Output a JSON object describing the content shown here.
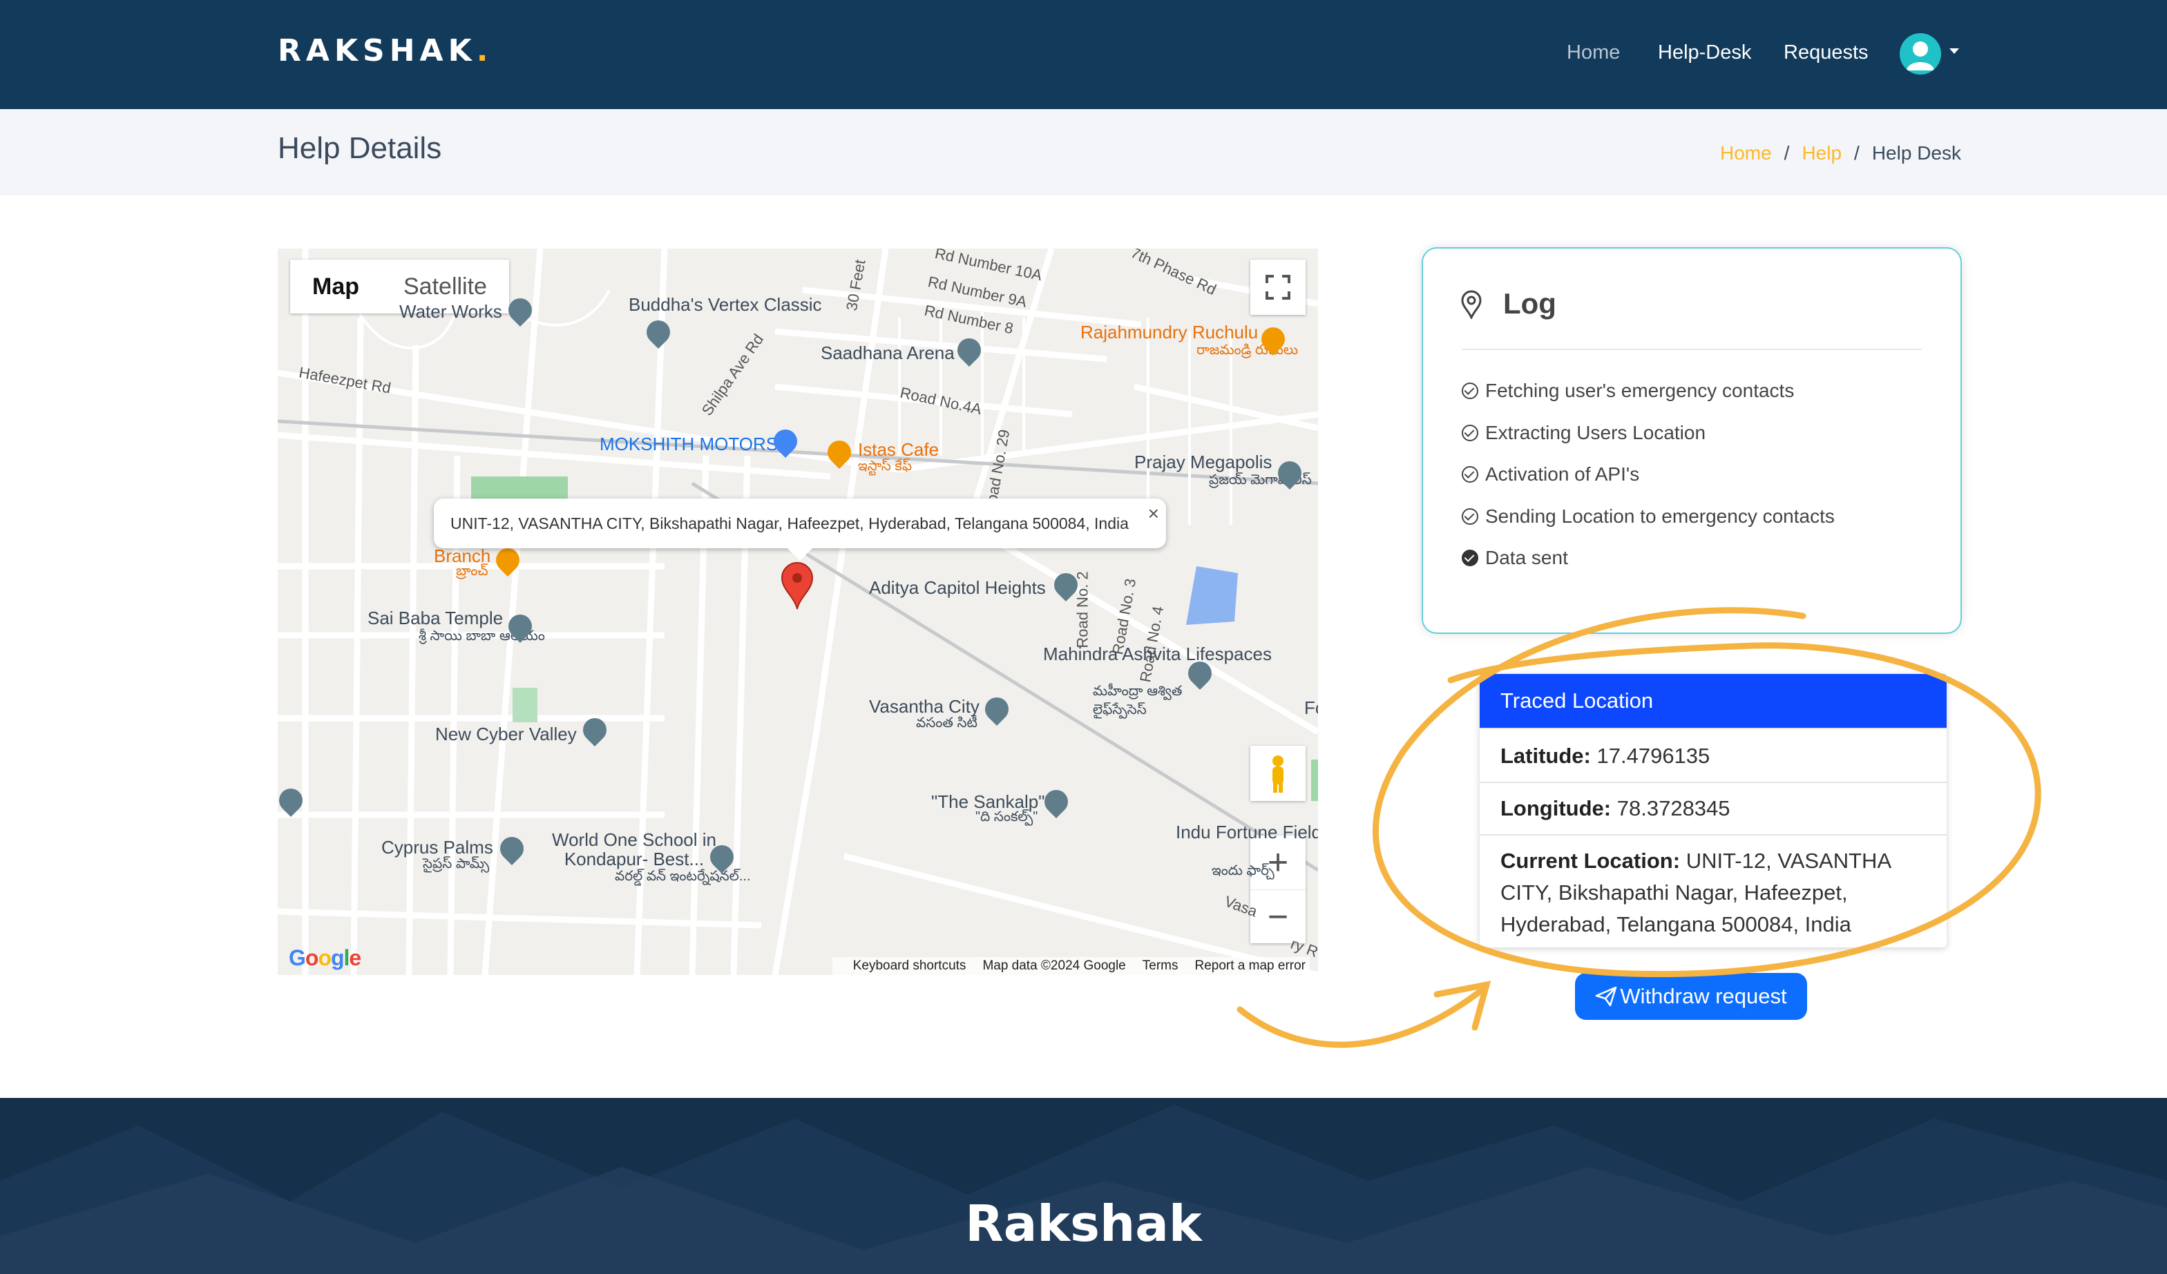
{
  "header": {
    "logo": "RAKSHAK",
    "logo_dot": ".",
    "nav": {
      "home": "Home",
      "help_desk": "Help-Desk",
      "requests": "Requests"
    },
    "avatar_icon": "user-avatar-icon",
    "colors": {
      "bg": "#123a5a",
      "accent": "#ffb727"
    }
  },
  "page": {
    "title": "Help Details",
    "breadcrumb": {
      "home": "Home",
      "help": "Help",
      "current": "Help Desk",
      "separator": "/"
    }
  },
  "map": {
    "type_buttons": {
      "map": "Map",
      "satellite": "Satellite"
    },
    "selected_type": "Map",
    "info_window": "UNIT-12, VASANTHA CITY, Bikshapathi Nagar, Hafeezpet, Hyderabad, Telangana 500084, India",
    "info_close": "×",
    "places": {
      "water_works": "Water Works",
      "buddha": "Buddha's Vertex Classic",
      "saadhana": "Saadhana Arena",
      "rajahmundry": "Rajahmundry Ruchulu",
      "rajahmundry_te": "రాజమండ్రి రుచులు",
      "mokshith": "MOKSHITH MOTORS",
      "istas": "Istas Cafe",
      "istas_te": "ఇస్టాస్ కేఫ్",
      "prajay": "Prajay Megapolis",
      "prajay_te": "ప్రజయ్ మెగాపోలిస్",
      "branch": "Branch",
      "branch_te": "బ్రాంచ్",
      "aditya": "Aditya Capitol Heights",
      "sai_baba": "Sai Baba Temple",
      "sai_baba_te": "శ్రీ సాయి బాబా ఆలయం",
      "mahindra": "Mahindra Ashvita Lifespaces",
      "mahindra_te": "మహీంద్రా ఆశ్విత లైఫ్‌స్పేసెస్",
      "new_cyber": "New Cyber Valley",
      "vasantha": "Vasantha City",
      "vasantha_te": "వసంత సిటీ",
      "sankalp": "\"The Sankalp\"",
      "sankalp_te": "\"ది సంకల్ప్\"",
      "indu": "Indu Fortune Fields Garde",
      "indu_te": "ఇందు ఫార్చ్",
      "cyprus": "Cyprus Palms",
      "cyprus_te": "సైప్రస్ పామ్స్",
      "world_one": "World One School in Kondapur- Best...",
      "world_one_te": "వరల్డ్ వన్ ఇంటర్నేషనల్...",
      "fo": "Fo"
    },
    "roads": {
      "hafeezpet": "Hafeezpet Rd",
      "shilpa": "Shilpa Ave Rd",
      "road4a": "Road No.4A",
      "road29": "Road No. 29",
      "rd10a": "Rd Number 10A",
      "rd9a": "Rd Number 9A",
      "rd8": "Rd Number 8",
      "feet30": "30 Feet",
      "phase": "7th Phase Rd",
      "road2": "Road No. 2",
      "road3": "Road No. 3",
      "road4": "Road No. 4",
      "vasa": "Vasa",
      "ry_r": "ry R"
    },
    "footer": {
      "shortcuts": "Keyboard shortcuts",
      "data": "Map data ©2024 Google",
      "terms": "Terms",
      "report": "Report a map error"
    },
    "google_logo": "Google",
    "controls": {
      "zoom_in": "+",
      "zoom_out": "−"
    }
  },
  "log": {
    "title": "Log",
    "icon": "location-pin-icon",
    "items": [
      "Fetching user's emergency contacts",
      "Extracting Users Location",
      "Activation of API's",
      "Sending Location to emergency contacts",
      "Data sent"
    ]
  },
  "traced": {
    "title": "Traced Location",
    "latitude_label": "Latitude:",
    "latitude": "17.4796135",
    "longitude_label": "Longitude:",
    "longitude": "78.3728345",
    "current_label": "Current Location:",
    "current": "UNIT-12, VASANTHA CITY, Bikshapathi Nagar, Hafeezpet, Hyderabad, Telangana 500084, India"
  },
  "withdraw": {
    "label": "Withdraw request",
    "icon": "send-icon"
  },
  "footer": {
    "title": "Rakshak"
  }
}
